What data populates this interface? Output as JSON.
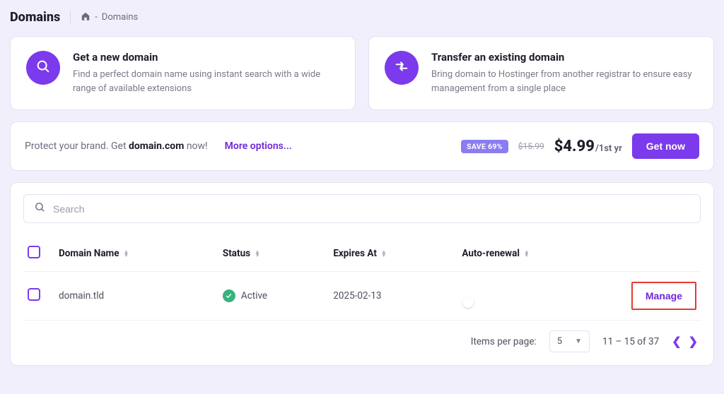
{
  "header": {
    "title": "Domains",
    "breadcrumb_sep": "-",
    "breadcrumb_current": "Domains"
  },
  "cards": {
    "get_domain": {
      "title": "Get a new domain",
      "desc": "Find a perfect domain name using instant search with a wide range of available extensions"
    },
    "transfer": {
      "title": "Transfer an existing domain",
      "desc": "Bring domain to Hostinger from another registrar to ensure easy management from a single place"
    }
  },
  "banner": {
    "text_prefix": "Protect your brand. Get ",
    "domain_bold": "domain.com",
    "text_suffix": " now!",
    "more_options": "More options...",
    "save_badge": "SAVE 69%",
    "old_price": "$15.99",
    "price": "$4.99",
    "period": "/1st yr",
    "cta": "Get now"
  },
  "search": {
    "placeholder": "Search"
  },
  "table": {
    "headers": {
      "name": "Domain Name",
      "status": "Status",
      "expires": "Expires At",
      "autorenew": "Auto-renewal"
    },
    "row": {
      "name": "domain.tld",
      "status": "Active",
      "expires": "2025-02-13",
      "manage": "Manage"
    }
  },
  "pagination": {
    "per_page_label": "Items per page:",
    "per_page_value": "5",
    "range": "11 – 15 of 37"
  }
}
